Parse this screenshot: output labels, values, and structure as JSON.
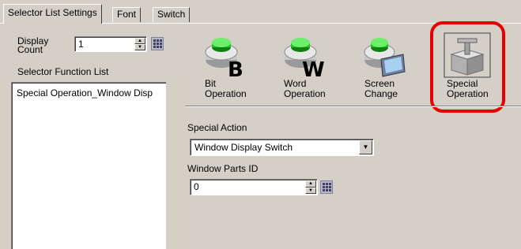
{
  "tabs": [
    {
      "label": "Selector List Settings"
    },
    {
      "label": "Font"
    },
    {
      "label": "Switch"
    }
  ],
  "display_count": {
    "label": "Display\nCount",
    "value": "1"
  },
  "selector_function_list": {
    "label": "Selector Function List",
    "items": [
      "Special Operation_Window Disp"
    ]
  },
  "operations": [
    {
      "label": "Bit\nOperation",
      "icon": "bit-operation-icon",
      "letter": "B"
    },
    {
      "label": "Word\nOperation",
      "icon": "word-operation-icon",
      "letter": "W"
    },
    {
      "label": "Screen\nChange",
      "icon": "screen-change-icon"
    },
    {
      "label": "Special\nOperation",
      "icon": "special-operation-icon",
      "highlighted": true
    }
  ],
  "special_action": {
    "label": "Special Action",
    "value": "Window Display Switch"
  },
  "window_parts_id": {
    "label": "Window Parts ID",
    "value": "0"
  },
  "colors": {
    "highlight": "#e60000",
    "button_green": "#22c022",
    "face": "#d4d0c8"
  }
}
